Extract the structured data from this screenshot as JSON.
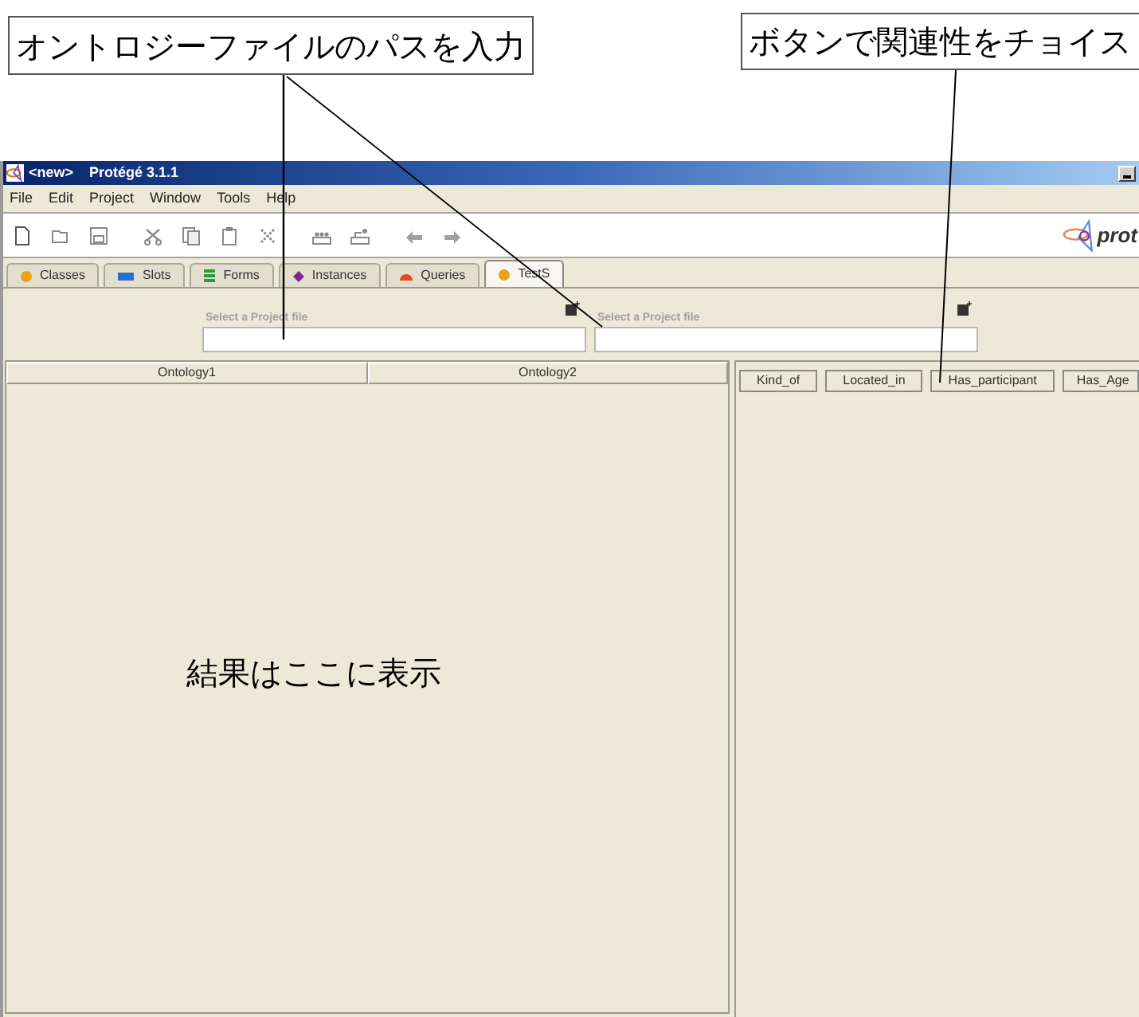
{
  "callouts": [
    {
      "text": "オントロジーファイルのパスを入力"
    },
    {
      "text": "ボタンで関連性をチョイス"
    }
  ],
  "window": {
    "project": "<new>",
    "title": "Protégé 3.1.1"
  },
  "menu": [
    "File",
    "Edit",
    "Project",
    "Window",
    "Tools",
    "Help"
  ],
  "toolbar": {
    "logo_text": "prot"
  },
  "tabs": [
    {
      "label": "Classes",
      "selected": false
    },
    {
      "label": "Slots",
      "selected": false
    },
    {
      "label": "Forms",
      "selected": false
    },
    {
      "label": "Instances",
      "selected": false
    },
    {
      "label": "Queries",
      "selected": false
    },
    {
      "label": "TestS",
      "selected": true
    }
  ],
  "file_fields": [
    {
      "label": "Select a Project file"
    },
    {
      "label": "Select a Project file"
    }
  ],
  "results_table": {
    "columns": [
      "Ontology1",
      "Ontology2"
    ],
    "note": "結果はここに表示"
  },
  "relation_buttons": [
    "Kind_of",
    "Located_in",
    "Has_participant",
    "Has_Age"
  ]
}
